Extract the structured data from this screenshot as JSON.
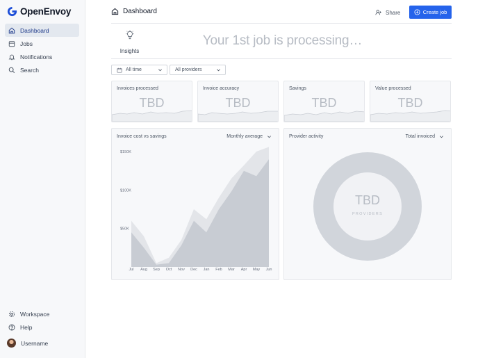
{
  "app": {
    "name": "OpenEnvoy"
  },
  "sidebar": {
    "items": [
      {
        "label": "Dashboard",
        "icon": "home-icon",
        "active": true
      },
      {
        "label": "Jobs",
        "icon": "jobs-icon"
      },
      {
        "label": "Notifications",
        "icon": "bell-icon"
      },
      {
        "label": "Search",
        "icon": "search-icon"
      }
    ],
    "bottom": [
      {
        "label": "Workspace",
        "icon": "gear-icon"
      },
      {
        "label": "Help",
        "icon": "help-icon"
      }
    ],
    "user": {
      "label": "Username",
      "icon": "avatar"
    }
  },
  "header": {
    "title": "Dashboard",
    "share_label": "Share",
    "create_label": "Create job"
  },
  "hero": {
    "insights_label": "Insights",
    "processing_text": "Your 1st job is processing…"
  },
  "filters": {
    "time": "All time",
    "providers": "All providers"
  },
  "stats": [
    {
      "label": "Invoices processed",
      "value": "TBD"
    },
    {
      "label": "Invoice accuracy",
      "value": "TBD"
    },
    {
      "label": "Savings",
      "value": "TBD"
    },
    {
      "label": "Value processed",
      "value": "TBD"
    }
  ],
  "cost_panel": {
    "title": "Invoice cost vs savings",
    "dropdown": "Monthly average"
  },
  "provider_panel": {
    "title": "Provider activity",
    "dropdown": "Total invoiced",
    "center_value": "TBD",
    "center_label": "PROVIDERS"
  },
  "colors": {
    "accent": "#2563eb",
    "placeholder_text": "#b7bcc4",
    "area_back": "#e3e5e9",
    "area_front": "#c8ccd3",
    "donut": "#d1d5db"
  },
  "chart_data": {
    "type": "area",
    "title": "Invoice cost vs savings",
    "categories": [
      "Jul",
      "Aug",
      "Sep",
      "Oct",
      "Nov",
      "Dec",
      "Jan",
      "Feb",
      "Mar",
      "Apr",
      "May",
      "Jun"
    ],
    "y_ticks": [
      "$50K",
      "$100K",
      "$150K"
    ],
    "ylim": [
      0,
      150000
    ],
    "series": [
      {
        "values": [
          60000,
          40000,
          5000,
          12000,
          35000,
          75000,
          62000,
          90000,
          115000,
          132000,
          150000,
          166000
        ]
      },
      {
        "values": [
          45000,
          25000,
          3000,
          5000,
          28000,
          60000,
          45000,
          75000,
          98000,
          125000,
          118000,
          140000
        ]
      }
    ],
    "grid": false,
    "legend": "none"
  }
}
